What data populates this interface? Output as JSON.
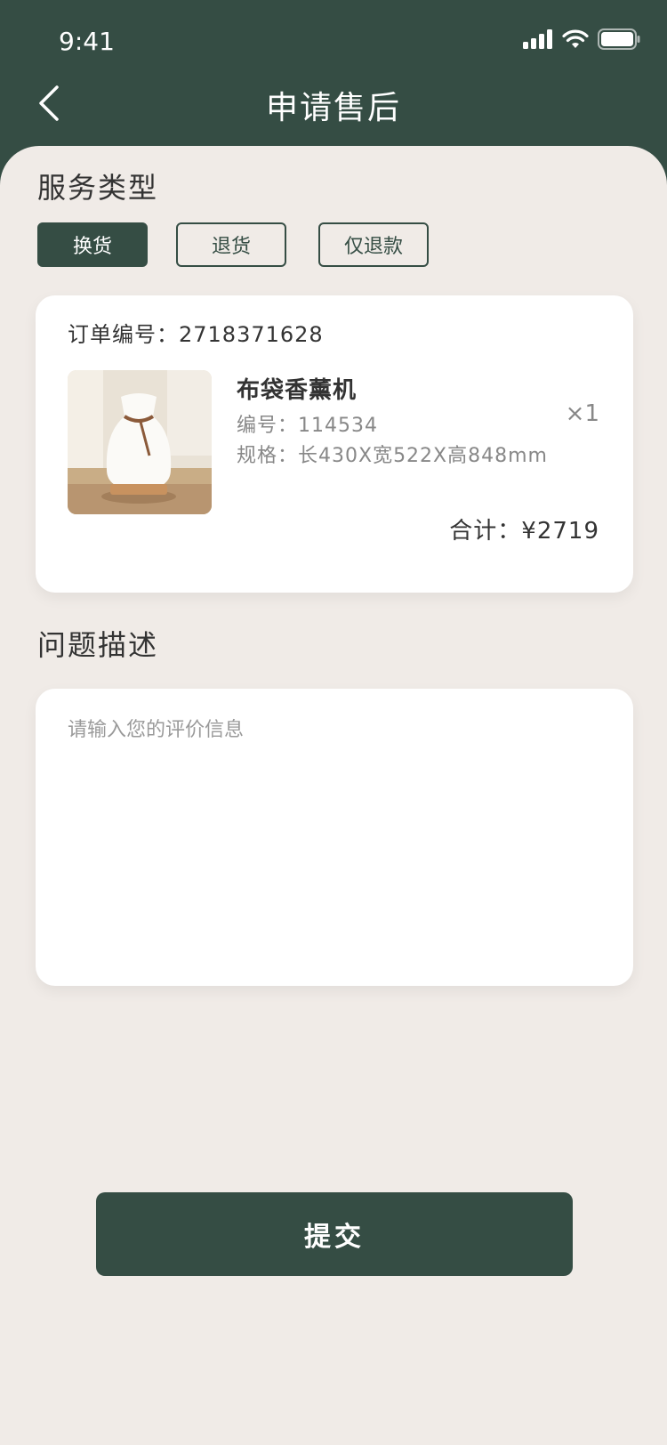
{
  "status_bar": {
    "time": "9:41"
  },
  "nav": {
    "title": "申请售后"
  },
  "service_type": {
    "title": "服务类型",
    "options": [
      {
        "label": "换货",
        "selected": true
      },
      {
        "label": "退货",
        "selected": false
      },
      {
        "label": "仅退款",
        "selected": false
      }
    ]
  },
  "order": {
    "order_number_text": "订单编号：2718371628",
    "product": {
      "name": "布袋香薰机",
      "code_text": "编号：114534",
      "spec_text": "规格：长430X宽522X高848mm",
      "quantity_text": "×1"
    },
    "total_text": "合计：¥2719"
  },
  "problem": {
    "title": "问题描述",
    "placeholder": "请输入您的评价信息"
  },
  "submit_label": "提交",
  "colors": {
    "brand": "#354d44",
    "background": "#f0ebe7"
  }
}
